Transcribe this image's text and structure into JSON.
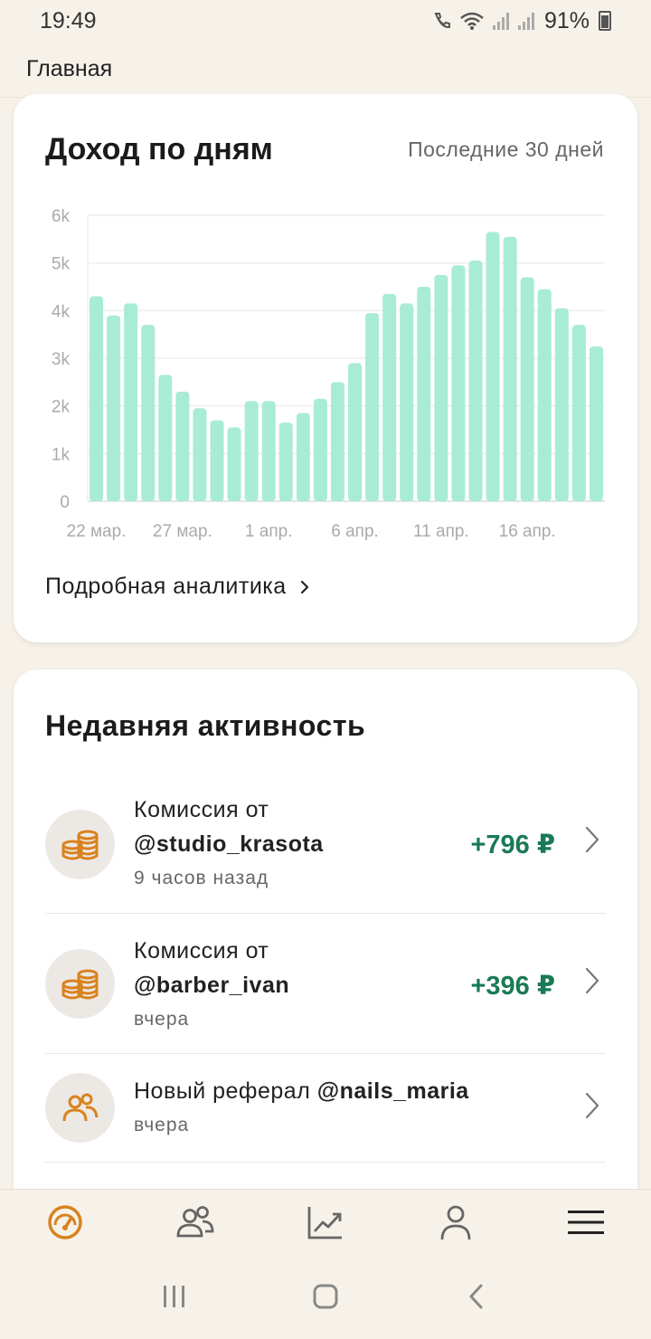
{
  "status_bar": {
    "time": "19:49",
    "battery": "91%"
  },
  "header": {
    "title": "Главная"
  },
  "income": {
    "title": "Доход по дням",
    "period": "Последние 30 дней",
    "link_label": "Подробная аналитика"
  },
  "chart_data": {
    "type": "bar",
    "title": "Доход по дням",
    "xlabel": "",
    "ylabel": "",
    "ylim": [
      0,
      6000
    ],
    "yticks": [
      "0",
      "1k",
      "2k",
      "3k",
      "4k",
      "5k",
      "6k"
    ],
    "xtick_labels": [
      "22 мар.",
      "27 мар.",
      "1 апр.",
      "6 апр.",
      "11 апр.",
      "16 апр."
    ],
    "categories": [
      "22 мар.",
      "23 мар.",
      "24 мар.",
      "25 мар.",
      "26 мар.",
      "27 мар.",
      "28 мар.",
      "29 мар.",
      "30 мар.",
      "31 мар.",
      "1 апр.",
      "2 апр.",
      "3 апр.",
      "4 апр.",
      "5 апр.",
      "6 апр.",
      "7 апр.",
      "8 апр.",
      "9 апр.",
      "10 апр.",
      "11 апр.",
      "12 апр.",
      "13 апр.",
      "14 апр.",
      "15 апр.",
      "16 апр.",
      "17 апр.",
      "18 апр.",
      "19 апр.",
      "20 апр."
    ],
    "values": [
      4300,
      3900,
      4150,
      3700,
      2650,
      2300,
      1950,
      1700,
      1550,
      2100,
      2100,
      1650,
      1850,
      2150,
      2500,
      2900,
      3950,
      4350,
      4150,
      4500,
      4750,
      4950,
      5050,
      5650,
      5550,
      4700,
      4450,
      4050,
      3700,
      3250
    ],
    "bar_color": "#a8ecd4",
    "grid": true
  },
  "activity": {
    "title": "Недавняя активность",
    "items": [
      {
        "line1": "Комиссия от",
        "handle": "@studio_krasota",
        "time": "9 часов назад",
        "amount": "+796 ₽",
        "icon": "coins-icon"
      },
      {
        "line1": "Комиссия от",
        "handle": "@barber_ivan",
        "time": "вчера",
        "amount": "+396 ₽",
        "icon": "coins-icon"
      },
      {
        "line1": "Новый реферал",
        "handle": "@nails_maria",
        "time": "вчера",
        "amount": "",
        "icon": "referral-icon"
      }
    ]
  },
  "colors": {
    "accent": "#d9821e",
    "amount": "#1a7a55",
    "bar": "#a8ecd4"
  },
  "nav": {
    "items": [
      "dashboard-icon",
      "users-icon",
      "chart-icon",
      "profile-icon",
      "menu-icon"
    ],
    "active": 0
  }
}
